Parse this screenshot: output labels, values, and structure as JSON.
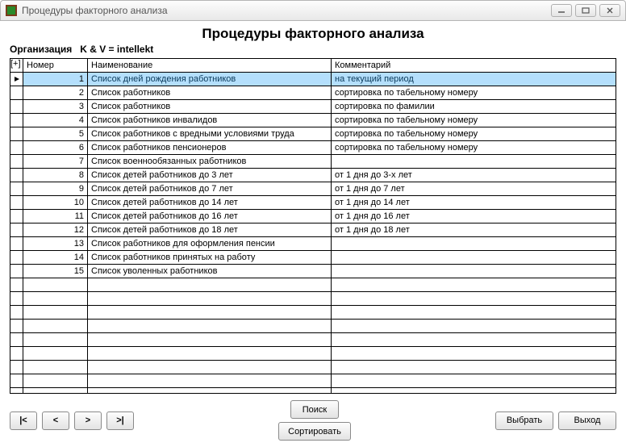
{
  "window": {
    "title": "Процедуры факторного анализа"
  },
  "heading": "Процедуры факторного анализа",
  "org_label": "Организация",
  "org_value": "K & V = intellekt",
  "columns": {
    "marker": "[+]",
    "num": "Номер",
    "name": "Наименование",
    "comment": "Комментарий"
  },
  "rows": [
    {
      "num": "1",
      "name": "Список дней рождения работников",
      "comment": "на текущий период",
      "selected": true
    },
    {
      "num": "2",
      "name": "Список работников",
      "comment": "сортировка по табельному номеру"
    },
    {
      "num": "3",
      "name": "Список работников",
      "comment": "сортировка по фамилии"
    },
    {
      "num": "4",
      "name": "Список работников инвалидов",
      "comment": "сортировка по табельному номеру"
    },
    {
      "num": "5",
      "name": "Список работников с вредными условиями труда",
      "comment": "сортировка по табельному номеру"
    },
    {
      "num": "6",
      "name": "Список работников пенсионеров",
      "comment": "сортировка по табельному номеру"
    },
    {
      "num": "7",
      "name": "Список военнообязанных работников",
      "comment": ""
    },
    {
      "num": "8",
      "name": "Список детей работников до 3 лет",
      "comment": "от 1 дня до 3-х лет"
    },
    {
      "num": "9",
      "name": "Список детей работников до 7 лет",
      "comment": "от 1 дня до 7 лет"
    },
    {
      "num": "10",
      "name": "Список детей работников до 14 лет",
      "comment": "от 1 дня до 14 лет"
    },
    {
      "num": "11",
      "name": "Список детей работников до 16 лет",
      "comment": "от 1 дня до 16 лет"
    },
    {
      "num": "12",
      "name": "Список детей работников до 18 лет",
      "comment": "от 1 дня до 18 лет"
    },
    {
      "num": "13",
      "name": "Список работников для оформления пенсии",
      "comment": ""
    },
    {
      "num": "14",
      "name": "Список работников принятых на работу",
      "comment": ""
    },
    {
      "num": "15",
      "name": "Список уволенных работников",
      "comment": ""
    }
  ],
  "empty_rows": 10,
  "buttons": {
    "nav_first": "|<",
    "nav_prev": "<",
    "nav_next": ">",
    "nav_last": ">|",
    "search": "Поиск",
    "sort": "Сортировать",
    "select": "Выбрать",
    "exit": "Выход"
  }
}
